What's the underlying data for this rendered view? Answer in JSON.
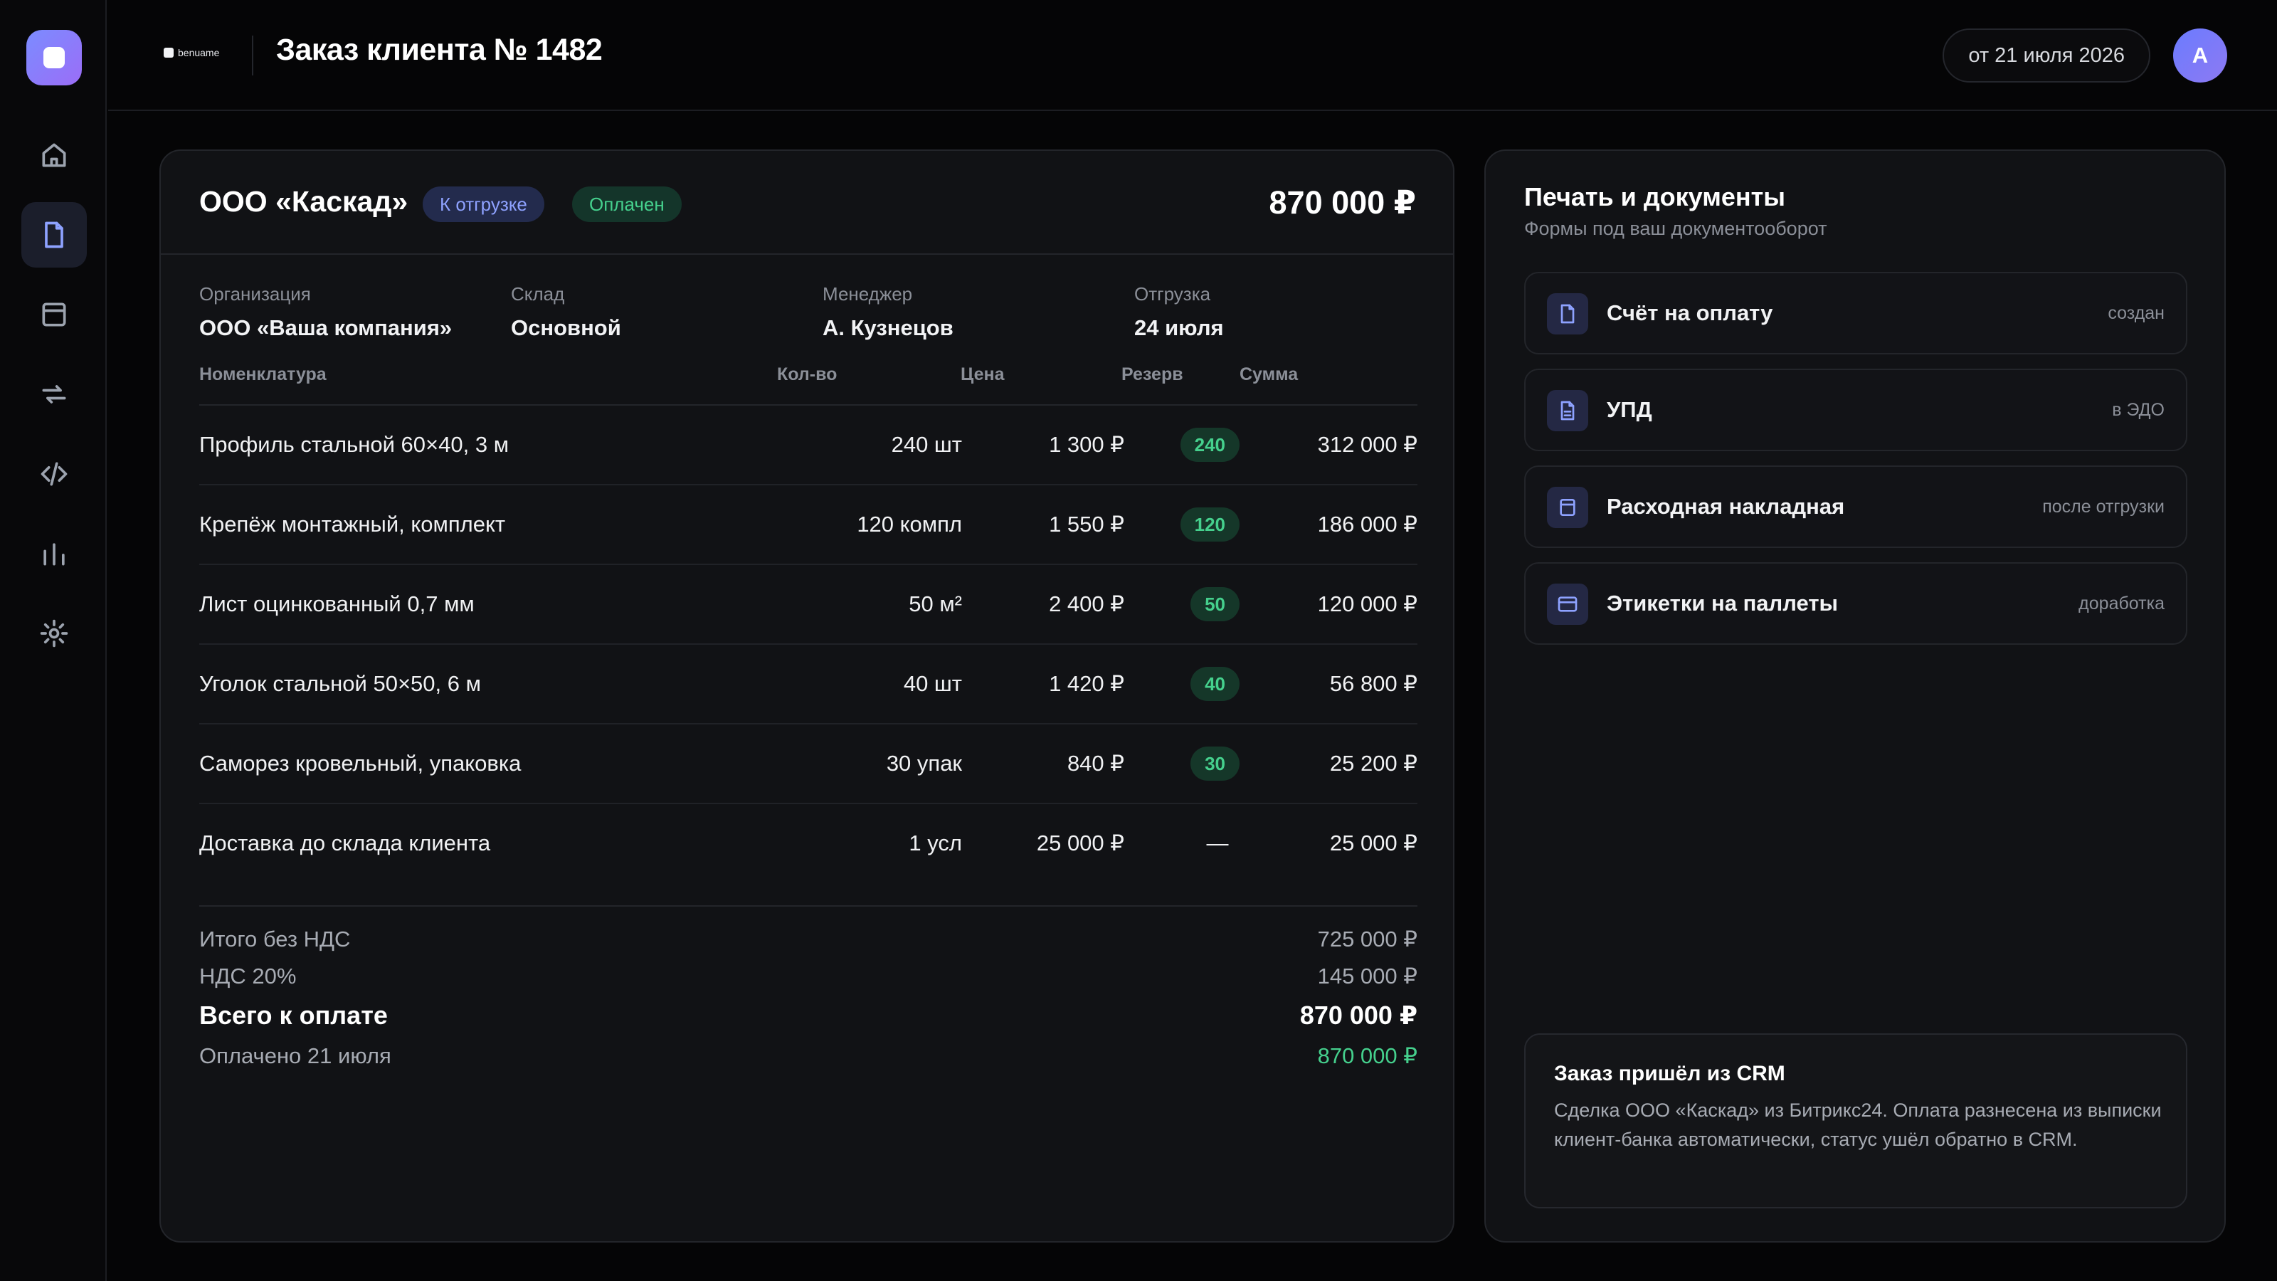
{
  "header": {
    "brand": "benuame",
    "title": "Заказ клиента № 1482",
    "date": "от 21 июля 2026",
    "avatar_initial": "А"
  },
  "rail": {
    "items": [
      {
        "icon": "home-icon",
        "active": false
      },
      {
        "icon": "document-icon",
        "active": true
      },
      {
        "icon": "box-icon",
        "active": false
      },
      {
        "icon": "sync-icon",
        "active": false
      },
      {
        "icon": "code-icon",
        "active": false
      },
      {
        "icon": "chart-icon",
        "active": false
      },
      {
        "icon": "gear-icon",
        "active": false
      }
    ]
  },
  "order": {
    "client": "ООО «Каскад»",
    "badge_shipping": "К отгрузке",
    "badge_paid": "Оплачен",
    "total": "870 000 ₽",
    "meta": [
      {
        "label": "Организация",
        "value": "ООО «Ваша компания»"
      },
      {
        "label": "Склад",
        "value": "Основной"
      },
      {
        "label": "Менеджер",
        "value": "А. Кузнецов"
      },
      {
        "label": "Отгрузка",
        "value": "24 июля"
      }
    ],
    "columns": {
      "name": "Номенклатура",
      "qty": "Кол-во",
      "price": "Цена",
      "reserve": "Резерв",
      "sum": "Сумма"
    },
    "rows": [
      {
        "name": "Профиль стальной 60×40, 3 м",
        "qty": "240 шт",
        "price": "1 300 ₽",
        "reserve": "240",
        "sum": "312 000 ₽"
      },
      {
        "name": "Крепёж монтажный, комплект",
        "qty": "120 компл",
        "price": "1 550 ₽",
        "reserve": "120",
        "sum": "186 000 ₽"
      },
      {
        "name": "Лист оцинкованный 0,7 мм",
        "qty": "50 м²",
        "price": "2 400 ₽",
        "reserve": "50",
        "sum": "120 000 ₽"
      },
      {
        "name": "Уголок стальной 50×50, 6 м",
        "qty": "40 шт",
        "price": "1 420 ₽",
        "reserve": "40",
        "sum": "56 800 ₽"
      },
      {
        "name": "Саморез кровельный, упаковка",
        "qty": "30 упак",
        "price": "840 ₽",
        "reserve": "30",
        "sum": "25 200 ₽"
      },
      {
        "name": "Доставка до склада клиента",
        "qty": "1 усл",
        "price": "25 000 ₽",
        "reserve": "—",
        "sum": "25 000 ₽"
      }
    ],
    "totals": {
      "net_label": "Итого без НДС",
      "net_value": "725 000 ₽",
      "vat_label": "НДС 20%",
      "vat_value": "145 000 ₽",
      "grand_label": "Всего к оплате",
      "grand_value": "870 000 ₽",
      "paid_label": "Оплачено 21 июля",
      "paid_value": "870 000 ₽"
    }
  },
  "docs": {
    "title": "Печать и документы",
    "subtitle": "Формы под ваш документооборот",
    "items": [
      {
        "name": "Счёт на оплату",
        "status": "создан",
        "icon": "document-icon"
      },
      {
        "name": "УПД",
        "status": "в ЭДО",
        "icon": "document-lines-icon"
      },
      {
        "name": "Расходная накладная",
        "status": "после отгрузки",
        "icon": "box-icon"
      },
      {
        "name": "Этикетки на паллеты",
        "status": "доработка",
        "icon": "card-icon"
      }
    ],
    "crm_title": "Заказ пришёл из CRM",
    "crm_text": "Сделка ООО «Каскад» из Битрикс24. Оплата разнесена из выписки клиент-банка автоматически, статус ушёл обратно в CRM."
  },
  "colors": {
    "accent": "#8ea2ff",
    "success": "#45d08d",
    "background": "#050506",
    "card": "#111215"
  }
}
